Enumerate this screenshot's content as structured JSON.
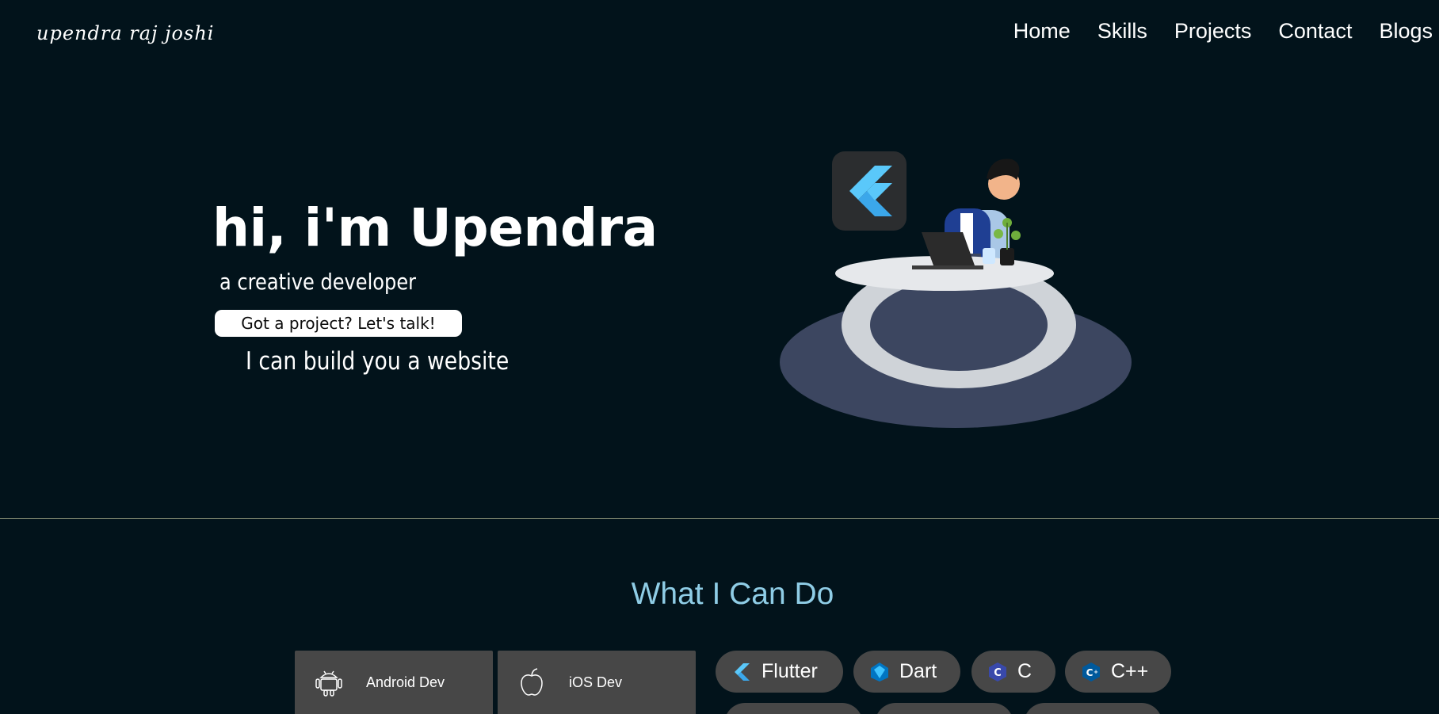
{
  "header": {
    "logo": "upendra raj joshi",
    "nav": [
      "Home",
      "Skills",
      "Projects",
      "Contact",
      "Blogs"
    ]
  },
  "hero": {
    "title": "hi, i'm Upendra",
    "subtitle": "a creative developer",
    "cta_label": "Got a project? Let's talk!",
    "typed_text": "I can build you a website"
  },
  "skills": {
    "title": "What I Can Do",
    "services": [
      {
        "label": "Android Dev",
        "icon": "android-icon"
      },
      {
        "label": "iOS Dev",
        "icon": "apple-icon"
      }
    ],
    "chips": [
      {
        "label": "Flutter",
        "icon": "flutter-icon"
      },
      {
        "label": "Dart",
        "icon": "dart-icon"
      },
      {
        "label": "C",
        "icon": "c-language-icon"
      },
      {
        "label": "C++",
        "icon": "cpp-icon"
      }
    ]
  },
  "colors": {
    "background": "#02131b",
    "accent": "#8fcde6",
    "card": "#474747",
    "divider": "#8a9077"
  }
}
